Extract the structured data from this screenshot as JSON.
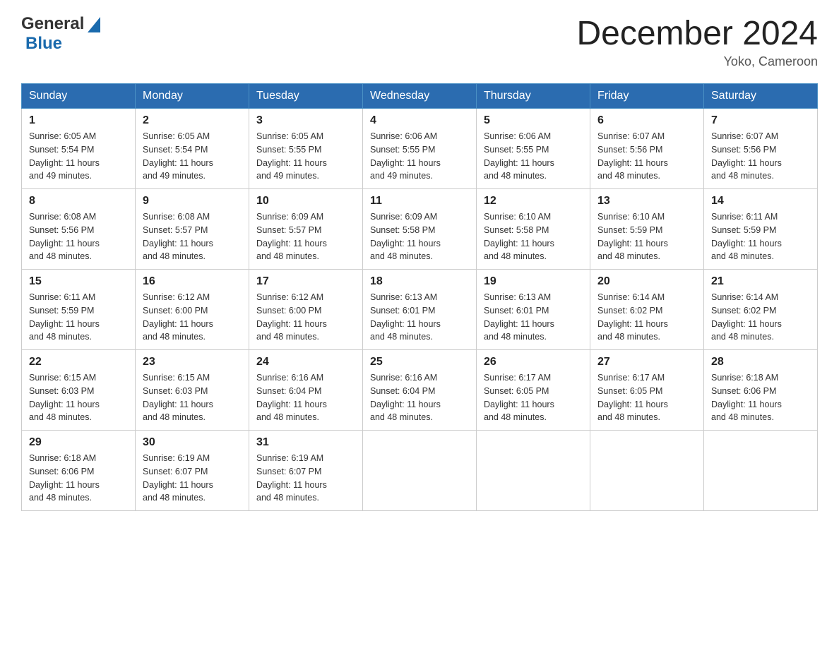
{
  "header": {
    "logo": {
      "general": "General",
      "arrow": "▶",
      "blue": "Blue"
    },
    "title": "December 2024",
    "location": "Yoko, Cameroon"
  },
  "days_of_week": [
    "Sunday",
    "Monday",
    "Tuesday",
    "Wednesday",
    "Thursday",
    "Friday",
    "Saturday"
  ],
  "weeks": [
    [
      {
        "day": "1",
        "sunrise": "6:05 AM",
        "sunset": "5:54 PM",
        "daylight": "11 hours and 49 minutes."
      },
      {
        "day": "2",
        "sunrise": "6:05 AM",
        "sunset": "5:54 PM",
        "daylight": "11 hours and 49 minutes."
      },
      {
        "day": "3",
        "sunrise": "6:05 AM",
        "sunset": "5:55 PM",
        "daylight": "11 hours and 49 minutes."
      },
      {
        "day": "4",
        "sunrise": "6:06 AM",
        "sunset": "5:55 PM",
        "daylight": "11 hours and 49 minutes."
      },
      {
        "day": "5",
        "sunrise": "6:06 AM",
        "sunset": "5:55 PM",
        "daylight": "11 hours and 48 minutes."
      },
      {
        "day": "6",
        "sunrise": "6:07 AM",
        "sunset": "5:56 PM",
        "daylight": "11 hours and 48 minutes."
      },
      {
        "day": "7",
        "sunrise": "6:07 AM",
        "sunset": "5:56 PM",
        "daylight": "11 hours and 48 minutes."
      }
    ],
    [
      {
        "day": "8",
        "sunrise": "6:08 AM",
        "sunset": "5:56 PM",
        "daylight": "11 hours and 48 minutes."
      },
      {
        "day": "9",
        "sunrise": "6:08 AM",
        "sunset": "5:57 PM",
        "daylight": "11 hours and 48 minutes."
      },
      {
        "day": "10",
        "sunrise": "6:09 AM",
        "sunset": "5:57 PM",
        "daylight": "11 hours and 48 minutes."
      },
      {
        "day": "11",
        "sunrise": "6:09 AM",
        "sunset": "5:58 PM",
        "daylight": "11 hours and 48 minutes."
      },
      {
        "day": "12",
        "sunrise": "6:10 AM",
        "sunset": "5:58 PM",
        "daylight": "11 hours and 48 minutes."
      },
      {
        "day": "13",
        "sunrise": "6:10 AM",
        "sunset": "5:59 PM",
        "daylight": "11 hours and 48 minutes."
      },
      {
        "day": "14",
        "sunrise": "6:11 AM",
        "sunset": "5:59 PM",
        "daylight": "11 hours and 48 minutes."
      }
    ],
    [
      {
        "day": "15",
        "sunrise": "6:11 AM",
        "sunset": "5:59 PM",
        "daylight": "11 hours and 48 minutes."
      },
      {
        "day": "16",
        "sunrise": "6:12 AM",
        "sunset": "6:00 PM",
        "daylight": "11 hours and 48 minutes."
      },
      {
        "day": "17",
        "sunrise": "6:12 AM",
        "sunset": "6:00 PM",
        "daylight": "11 hours and 48 minutes."
      },
      {
        "day": "18",
        "sunrise": "6:13 AM",
        "sunset": "6:01 PM",
        "daylight": "11 hours and 48 minutes."
      },
      {
        "day": "19",
        "sunrise": "6:13 AM",
        "sunset": "6:01 PM",
        "daylight": "11 hours and 48 minutes."
      },
      {
        "day": "20",
        "sunrise": "6:14 AM",
        "sunset": "6:02 PM",
        "daylight": "11 hours and 48 minutes."
      },
      {
        "day": "21",
        "sunrise": "6:14 AM",
        "sunset": "6:02 PM",
        "daylight": "11 hours and 48 minutes."
      }
    ],
    [
      {
        "day": "22",
        "sunrise": "6:15 AM",
        "sunset": "6:03 PM",
        "daylight": "11 hours and 48 minutes."
      },
      {
        "day": "23",
        "sunrise": "6:15 AM",
        "sunset": "6:03 PM",
        "daylight": "11 hours and 48 minutes."
      },
      {
        "day": "24",
        "sunrise": "6:16 AM",
        "sunset": "6:04 PM",
        "daylight": "11 hours and 48 minutes."
      },
      {
        "day": "25",
        "sunrise": "6:16 AM",
        "sunset": "6:04 PM",
        "daylight": "11 hours and 48 minutes."
      },
      {
        "day": "26",
        "sunrise": "6:17 AM",
        "sunset": "6:05 PM",
        "daylight": "11 hours and 48 minutes."
      },
      {
        "day": "27",
        "sunrise": "6:17 AM",
        "sunset": "6:05 PM",
        "daylight": "11 hours and 48 minutes."
      },
      {
        "day": "28",
        "sunrise": "6:18 AM",
        "sunset": "6:06 PM",
        "daylight": "11 hours and 48 minutes."
      }
    ],
    [
      {
        "day": "29",
        "sunrise": "6:18 AM",
        "sunset": "6:06 PM",
        "daylight": "11 hours and 48 minutes."
      },
      {
        "day": "30",
        "sunrise": "6:19 AM",
        "sunset": "6:07 PM",
        "daylight": "11 hours and 48 minutes."
      },
      {
        "day": "31",
        "sunrise": "6:19 AM",
        "sunset": "6:07 PM",
        "daylight": "11 hours and 48 minutes."
      },
      null,
      null,
      null,
      null
    ]
  ],
  "labels": {
    "sunrise": "Sunrise:",
    "sunset": "Sunset:",
    "daylight": "Daylight:"
  }
}
